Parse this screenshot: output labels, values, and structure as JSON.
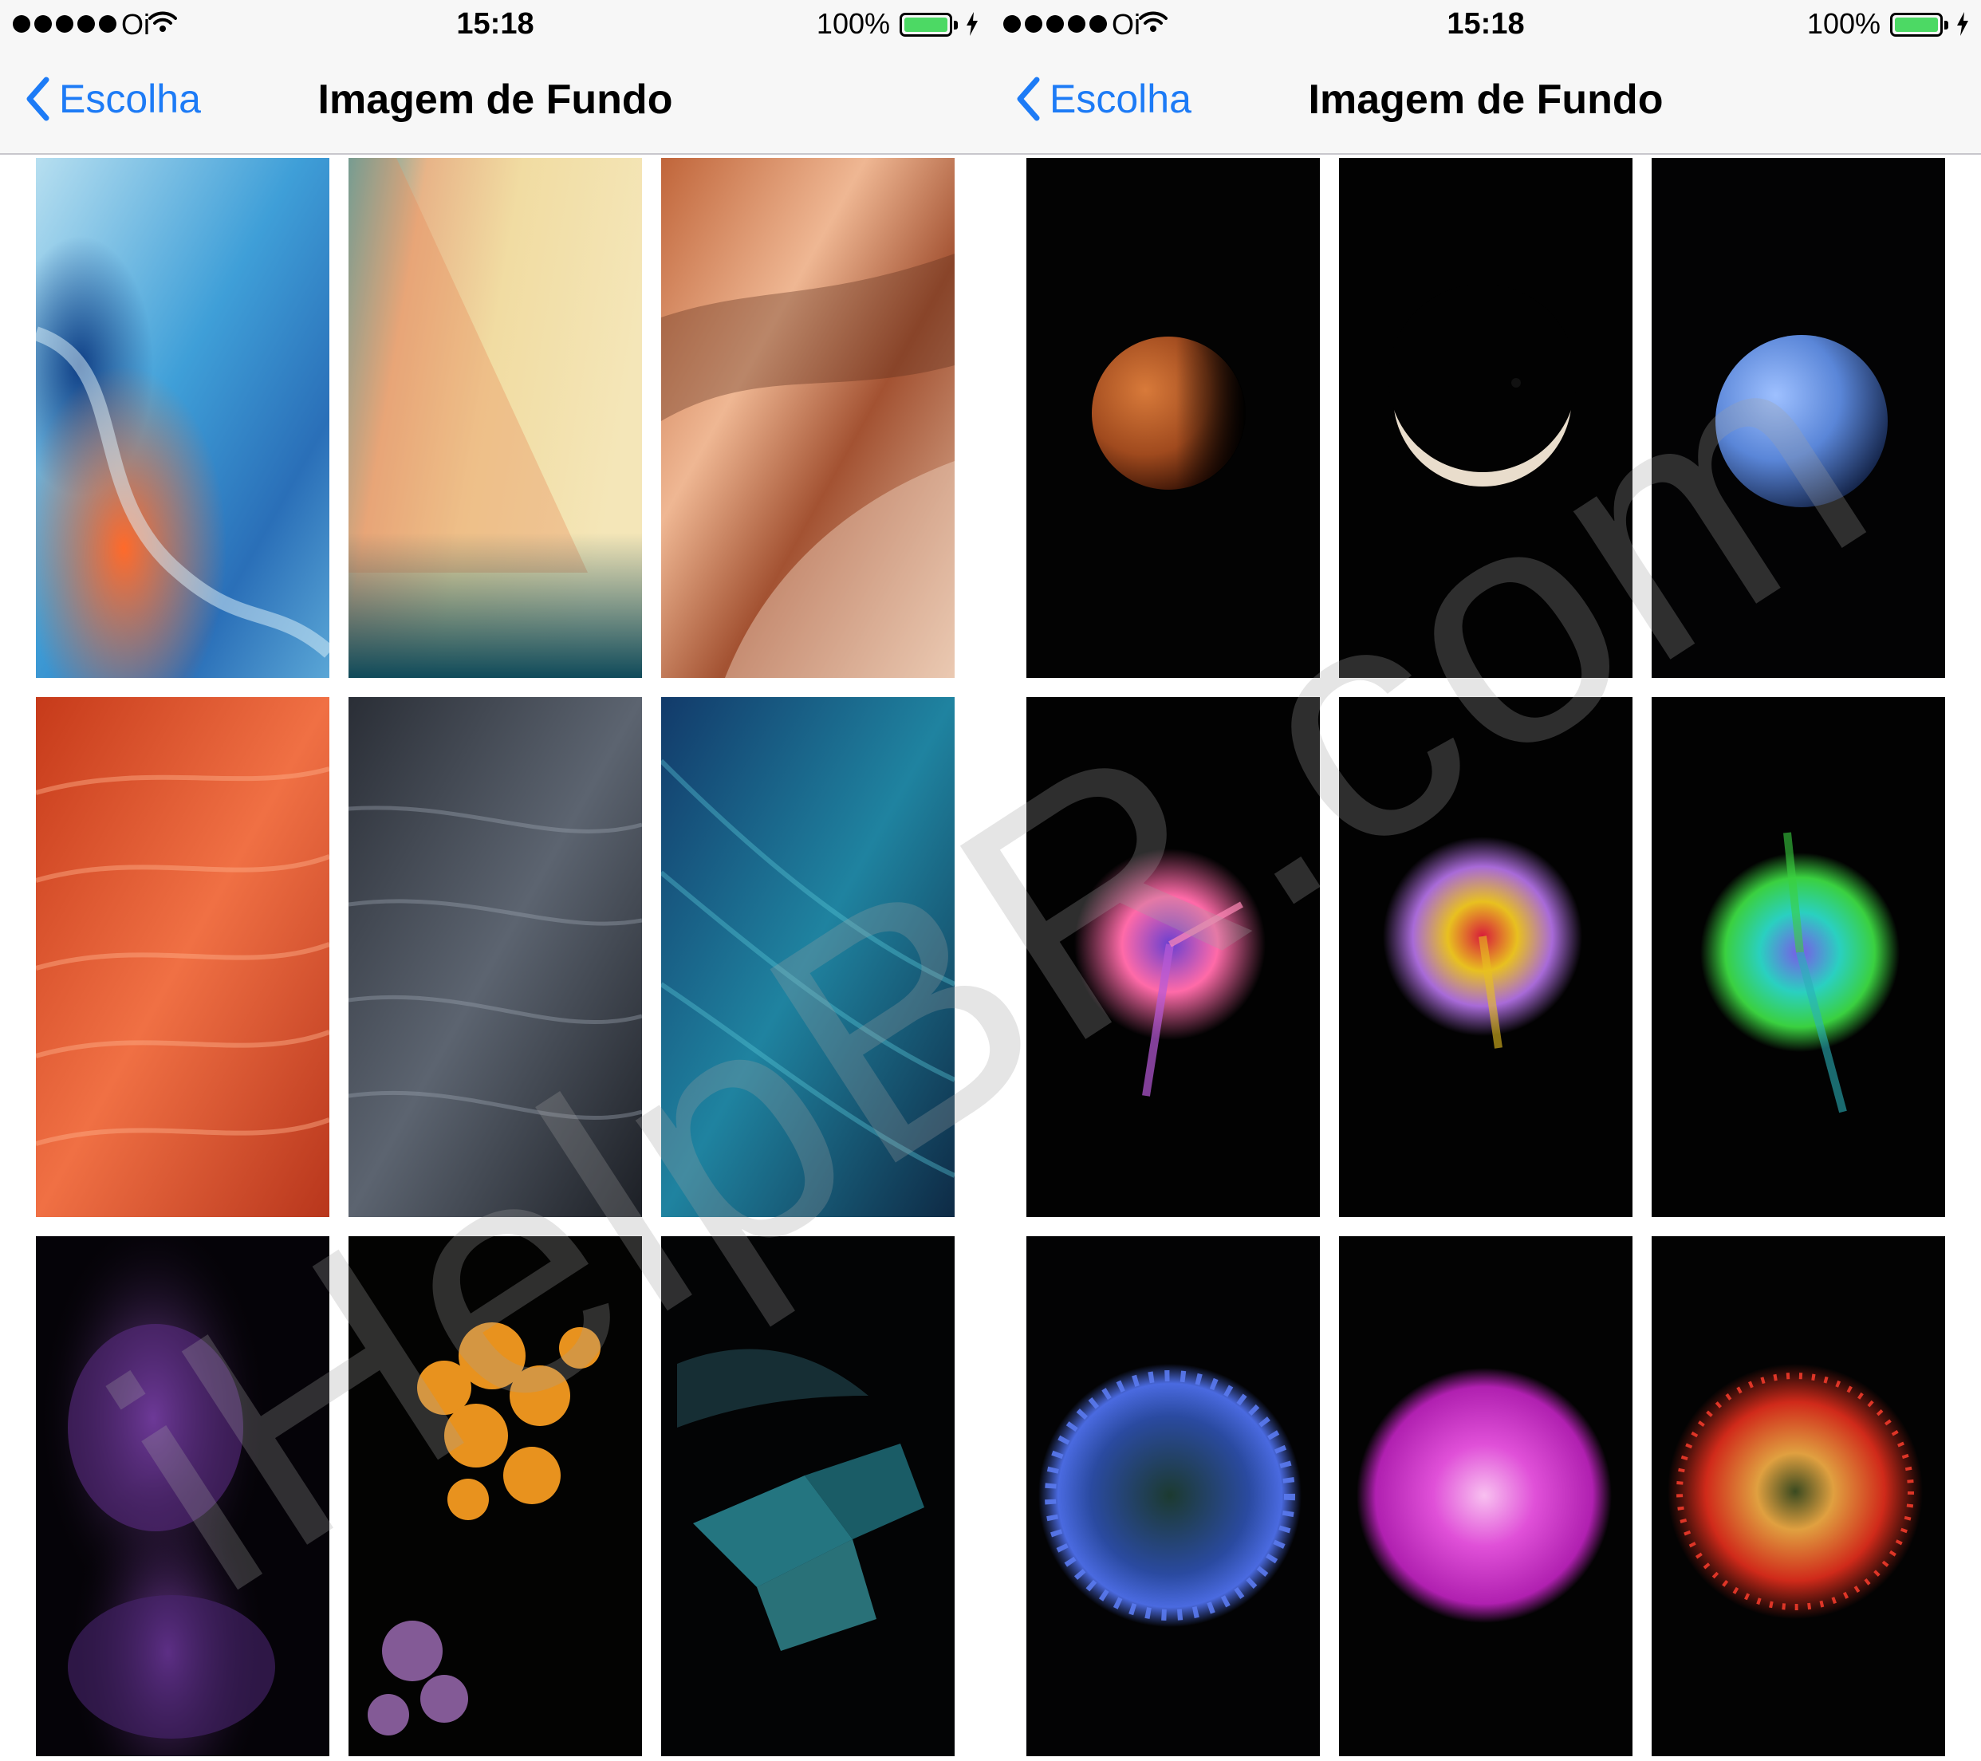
{
  "screens": [
    {
      "status": {
        "carrier": "Oi",
        "time": "15:18",
        "battery": "100%"
      },
      "nav": {
        "back_label": "Escolha",
        "title": "Imagem de Fundo"
      },
      "wallpapers": [
        {
          "name": "wallpaper-blue-sand-swirl"
        },
        {
          "name": "wallpaper-cream-teal-dune"
        },
        {
          "name": "wallpaper-orange-sand-dune"
        },
        {
          "name": "wallpaper-orange-feathers"
        },
        {
          "name": "wallpaper-grey-feathers"
        },
        {
          "name": "wallpaper-blue-feathers"
        },
        {
          "name": "wallpaper-purple-rose"
        },
        {
          "name": "wallpaper-orange-flowers"
        },
        {
          "name": "wallpaper-teal-leaves"
        }
      ]
    },
    {
      "status": {
        "carrier": "Oi",
        "time": "15:18",
        "battery": "100%"
      },
      "nav": {
        "back_label": "Escolha",
        "title": "Imagem de Fundo"
      },
      "wallpapers": [
        {
          "name": "wallpaper-mars"
        },
        {
          "name": "wallpaper-jupiter-crescent"
        },
        {
          "name": "wallpaper-neptune"
        },
        {
          "name": "wallpaper-pink-powder-burst"
        },
        {
          "name": "wallpaper-yellow-red-powder-burst"
        },
        {
          "name": "wallpaper-green-teal-powder-burst"
        },
        {
          "name": "wallpaper-blue-flower"
        },
        {
          "name": "wallpaper-magenta-dahlia"
        },
        {
          "name": "wallpaper-red-pincushion-flower"
        }
      ]
    }
  ],
  "watermark": "iHelpBR.com"
}
